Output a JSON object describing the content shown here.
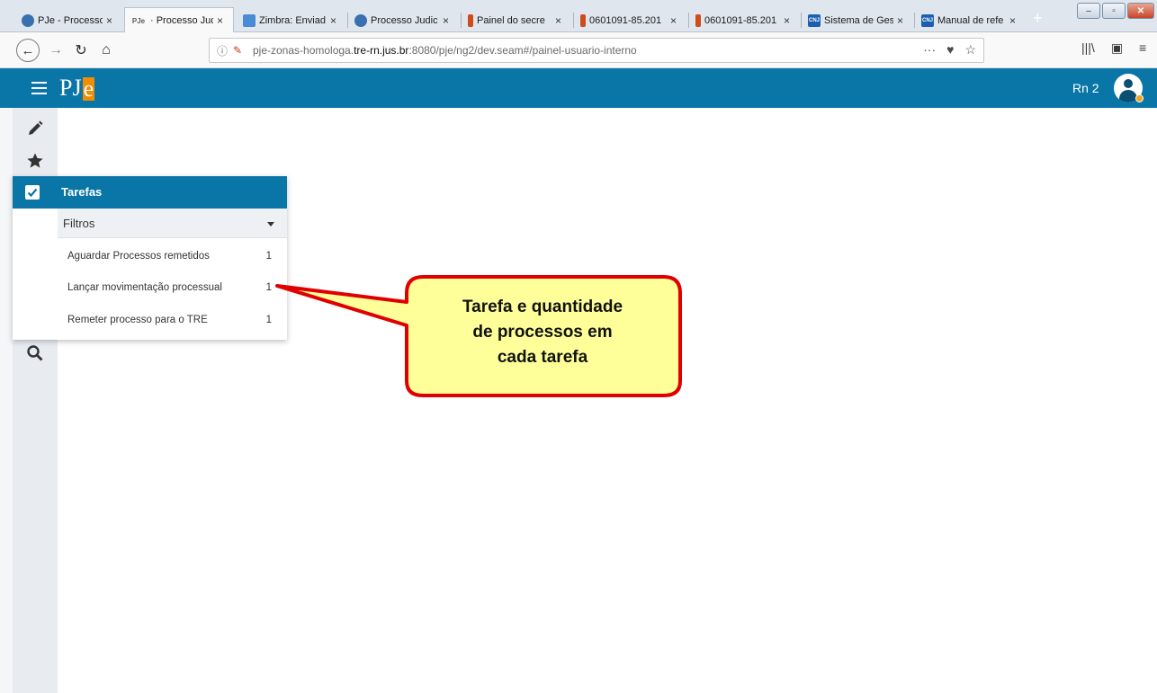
{
  "browser": {
    "tabs": [
      {
        "title": "PJe - Processo",
        "icon": "pje-globe-icon",
        "icon_color": "#3a6fb0",
        "close": "×"
      },
      {
        "title": "· Processo Judi",
        "icon": "pje-logo-icon",
        "icon_text": "PJe",
        "icon_color": "#5a5a5a",
        "close": "×",
        "active": true
      },
      {
        "title": "Zimbra: Enviad",
        "icon": "zimbra-icon",
        "icon_color": "#4a8bd6",
        "close": "×"
      },
      {
        "title": "Processo Judic",
        "icon": "pje-globe-icon",
        "icon_color": "#3a6fb0",
        "close": "×"
      },
      {
        "title": "Painel do secre",
        "icon": "tse-icon",
        "icon_color": "#d04a1c",
        "close": "×"
      },
      {
        "title": "0601091-85.201",
        "icon": "tse-icon",
        "icon_color": "#d04a1c",
        "close": "×"
      },
      {
        "title": "0601091-85.201",
        "icon": "tse-icon",
        "icon_color": "#d04a1c",
        "close": "×"
      },
      {
        "title": "Sistema de Ges",
        "icon": "cnj-icon",
        "icon_text": "CNJ",
        "icon_color": "#1c5fae",
        "close": "×"
      },
      {
        "title": "Manual de refe",
        "icon": "cnj-icon",
        "icon_text": "CNJ",
        "icon_color": "#1c5fae",
        "close": "×"
      }
    ],
    "new_tab": "+",
    "window_controls": [
      "–",
      "▫",
      "✕"
    ],
    "nav": {
      "back": "←",
      "forward": "→",
      "reload": "↻",
      "home": "⌂"
    },
    "url": {
      "prefix": "pje-zonas-homologa.",
      "domain": "tre-rn.jus.br",
      "suffix": ":8080/pje/ng2/dev.seam#/painel-usuario-interno"
    },
    "url_actions": [
      "···",
      "♥",
      "☆"
    ],
    "toolbar_right": [
      "|||\\",
      "▣",
      "≡"
    ]
  },
  "app": {
    "logo_pj": "PJ",
    "logo_e": "e",
    "user_name": "Rn 2",
    "brand_color": "#0a76a8",
    "accent_color": "#f28c00"
  },
  "sidebar": {
    "icons": [
      "pencil-icon",
      "star-icon",
      "checkbox-icon",
      "tags-icon",
      "copy-icon",
      "envelope-icon",
      "history-icon",
      "search-icon"
    ]
  },
  "tasks_panel": {
    "title": "Tarefas",
    "filter_label": "Filtros",
    "tasks": [
      {
        "name": "Aguardar Processos remetidos",
        "count": "1"
      },
      {
        "name": "Lançar movimentação processual",
        "count": "1"
      },
      {
        "name": "Remeter processo para o TRE",
        "count": "1"
      }
    ]
  },
  "callout": {
    "lines": [
      "Tarefa e quantidade",
      "de processos em",
      "cada tarefa"
    ],
    "fill": "#ffff99",
    "stroke": "#e00000"
  }
}
